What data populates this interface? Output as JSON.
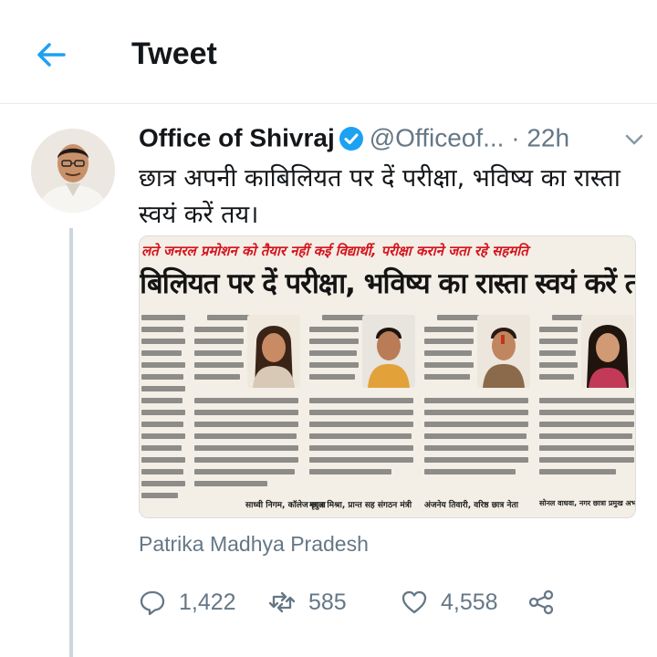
{
  "header": {
    "title": "Tweet"
  },
  "tweet": {
    "author_name": "Office of Shivraj",
    "handle": "@Officeof...",
    "separator": "·",
    "time": "22h",
    "text": "छात्र अपनी काबिलियत पर दें परीक्षा, भविष्य का रास्ता स्वयं करें तय।",
    "source": "Patrika Madhya Pradesh"
  },
  "media": {
    "top_band": "लते जनरल प्रमोशन को तैयार नहीं कई विद्यार्थी, परीक्षा कराने जता रहे सहमति",
    "headline": "बिलियत पर दें परीक्षा, भविष्य का रास्ता स्वयं करें तय",
    "bylines": [
      "साध्वी निगम, कॉलेज छात्रा",
      "मृदुल मिश्रा, प्रान्त सह संगठन मंत्री",
      "अंजनेय तिवारी, वरिष्ठ छात्र नेता",
      "सोनल वाधवा, नगर छात्रा प्रमुख अभाविप"
    ]
  },
  "actions": {
    "replies": "1,422",
    "retweets": "585",
    "likes": "4,558"
  },
  "colors": {
    "accent": "#1da1f2",
    "muted": "#657786",
    "divider": "#e6ecf0",
    "headline_red": "#d5141e"
  },
  "icons": [
    "back-arrow-icon",
    "verified-badge-icon",
    "chevron-down-icon",
    "reply-icon",
    "retweet-icon",
    "like-icon",
    "share-icon"
  ]
}
